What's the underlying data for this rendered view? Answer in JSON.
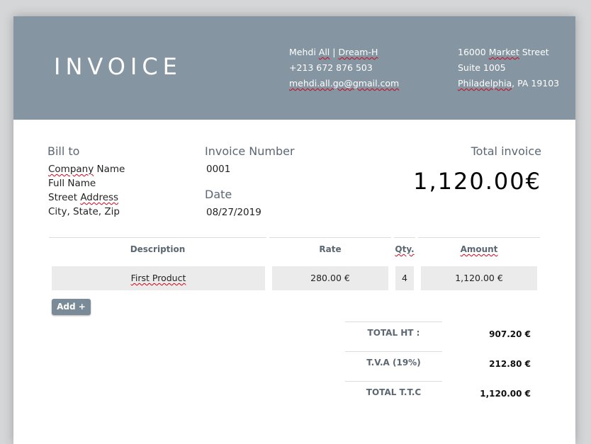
{
  "header": {
    "title": "INVOICE",
    "sender": {
      "name_first": "Mehdi ",
      "name_last": "All",
      "separator": " | ",
      "company": "Dream-H",
      "phone": "+213 672 876 503",
      "email": "mehdi.all.go@gmail.com"
    },
    "address": {
      "street_number": "16000 ",
      "street_name": "Market",
      "street_suffix": " Street",
      "suite": "Suite 1005",
      "city": "Philadelphia",
      "state_zip": ", PA 19103"
    },
    "colors": {
      "band": "#8595a1",
      "text": "#ffffff"
    }
  },
  "bill_to": {
    "label": "Bill to",
    "company_a": "Company",
    "company_b": " Name",
    "full_name": "Full Name",
    "street_a": "Street ",
    "street_b": "Address",
    "city": "City, State, Zip"
  },
  "invoice": {
    "number_label": "Invoice Number",
    "number": "0001",
    "date_label": "Date",
    "date": "08/27/2019",
    "total_label": "Total invoice",
    "total": "1,120.00€"
  },
  "table": {
    "headers": {
      "description": "Description",
      "rate": "Rate",
      "qty": "Qty.",
      "amount": "Amount"
    },
    "rows": [
      {
        "description": "First Product",
        "rate": "280.00 €",
        "qty": "4",
        "amount": "1,120.00 €"
      }
    ],
    "add_button": "Add +"
  },
  "summary": {
    "ht_label": "TOTAL HT :",
    "ht_value": "907.20 €",
    "tva_label": "T.V.A  (19%)",
    "tva_value": "212.80 €",
    "ttc_label": "TOTAL T.T.C",
    "ttc_value": "1,120.00 €"
  }
}
